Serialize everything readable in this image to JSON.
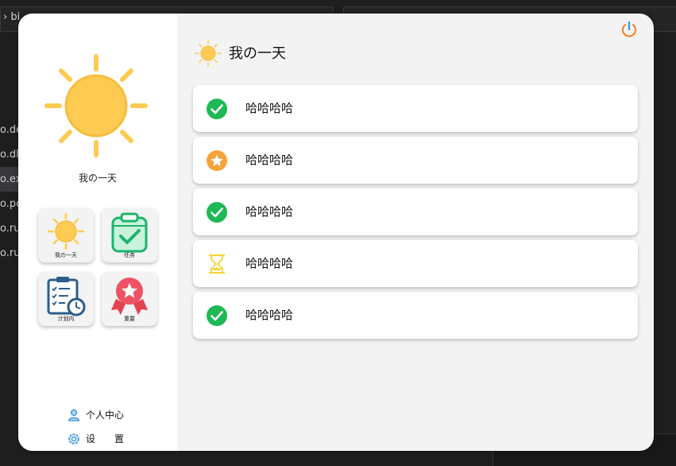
{
  "background": {
    "breadcrumb": "› bi",
    "files": [
      "o.de",
      "o.dll",
      "o.ex",
      "o.pc",
      "o.ru",
      "o.ru"
    ]
  },
  "sidebar": {
    "title": "我の一天",
    "tiles": [
      {
        "label": "我の一天",
        "icon": "sun-icon"
      },
      {
        "label": "任务",
        "icon": "clipboard-check-icon"
      },
      {
        "label": "计划内",
        "icon": "schedule-clipboard-icon"
      },
      {
        "label": "重要",
        "icon": "star-badge-icon"
      }
    ],
    "links": [
      {
        "label": "个人中心",
        "icon": "user-icon"
      },
      {
        "label": "设　　置",
        "icon": "settings-icon"
      }
    ]
  },
  "main": {
    "title": "我の一天",
    "tasks": [
      {
        "text": "哈哈哈哈",
        "status": "completed",
        "icon": "check-circle-icon",
        "color": "#1db954"
      },
      {
        "text": "哈哈哈哈",
        "status": "important",
        "icon": "star-circle-icon",
        "color": "#f7a33a"
      },
      {
        "text": "哈哈哈哈",
        "status": "completed",
        "icon": "check-circle-icon",
        "color": "#1db954"
      },
      {
        "text": "哈哈哈哈",
        "status": "pending",
        "icon": "hourglass-icon",
        "color": "#f2d53c"
      },
      {
        "text": "哈哈哈哈",
        "status": "completed",
        "icon": "check-circle-icon",
        "color": "#1db954"
      }
    ]
  },
  "colors": {
    "sun": "#fecb52",
    "check": "#1db954",
    "star": "#f7a33a",
    "hourglass": "#f2d53c",
    "power_ring": "#f47a20",
    "power_line": "#1fa3d8"
  }
}
